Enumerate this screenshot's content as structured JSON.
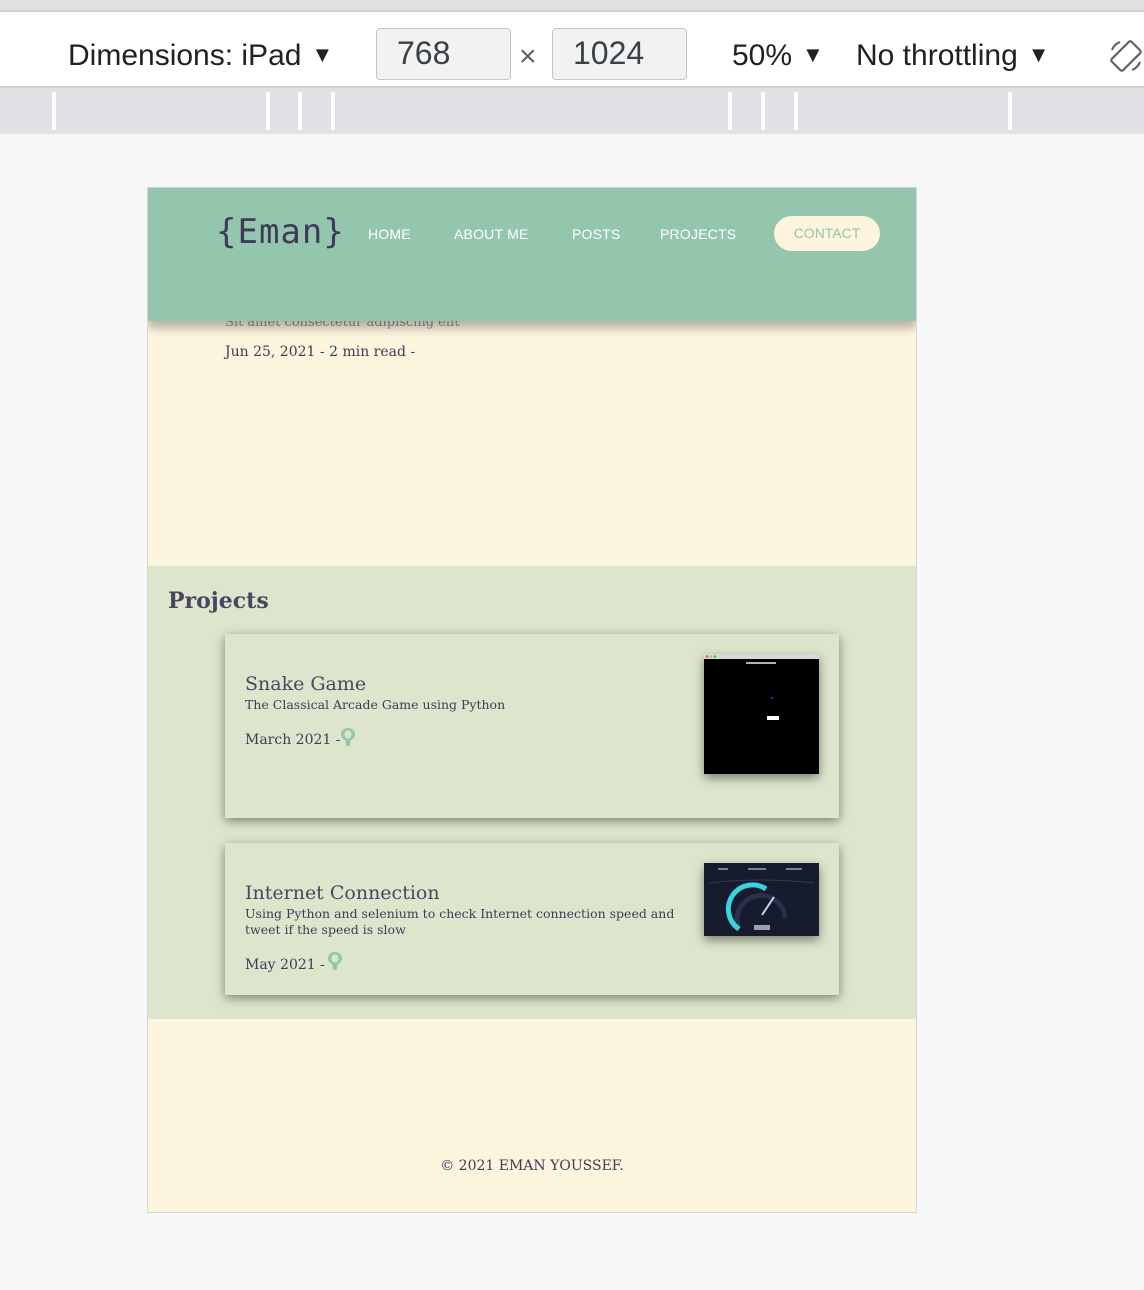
{
  "devtools": {
    "device_label": "Dimensions: iPad",
    "width": "768",
    "height": "1024",
    "times": "×",
    "zoom": "50%",
    "throttling": "No throttling",
    "caret": "▼"
  },
  "header": {
    "logo": "{Eman}",
    "nav": [
      "HOME",
      "ABOUT ME",
      "POSTS",
      "PROJECTS"
    ],
    "contact": "CONTACT"
  },
  "post": {
    "subtitle": "Sit amet consectetur adipiscing elit",
    "date": "Jun 25, 2021",
    "separator": "-",
    "read_time": "2 min read",
    "trailing": "-"
  },
  "projects": {
    "title": "Projects",
    "items": [
      {
        "title": "Snake Game",
        "description": "The Classical Arcade Game using Python",
        "date": "March 2021",
        "separator": "-",
        "thumbnail": "snake-game-screenshot"
      },
      {
        "title": "Internet Connection",
        "description": "Using Python and selenium to check Internet connection speed and tweet if the speed is slow",
        "date": "May 2021",
        "separator": "-",
        "thumbnail": "speedtest-screenshot"
      }
    ]
  },
  "footer": {
    "copyright": "© 2021 EMAN YOUSSEF."
  },
  "colors": {
    "header_bg": "#93c6ad",
    "page_bg": "#fdf4dd",
    "projects_bg": "#dde6cd",
    "text_dark": "#3f3a58"
  }
}
